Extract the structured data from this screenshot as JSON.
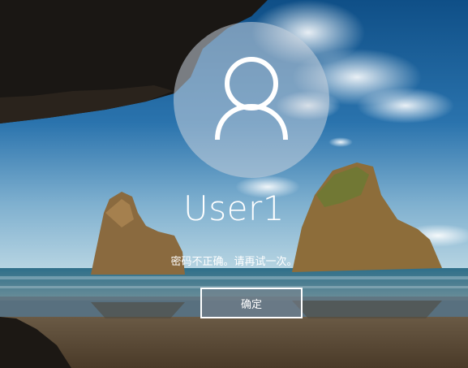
{
  "login": {
    "avatar_icon": "user-silhouette-icon",
    "username": "User1",
    "error_message": "密码不正确。请再试一次。",
    "ok_button_label": "确定"
  },
  "colors": {
    "text": "#ffffff",
    "avatar_fill": "#c8d2dc",
    "button_border": "#ffffff"
  }
}
